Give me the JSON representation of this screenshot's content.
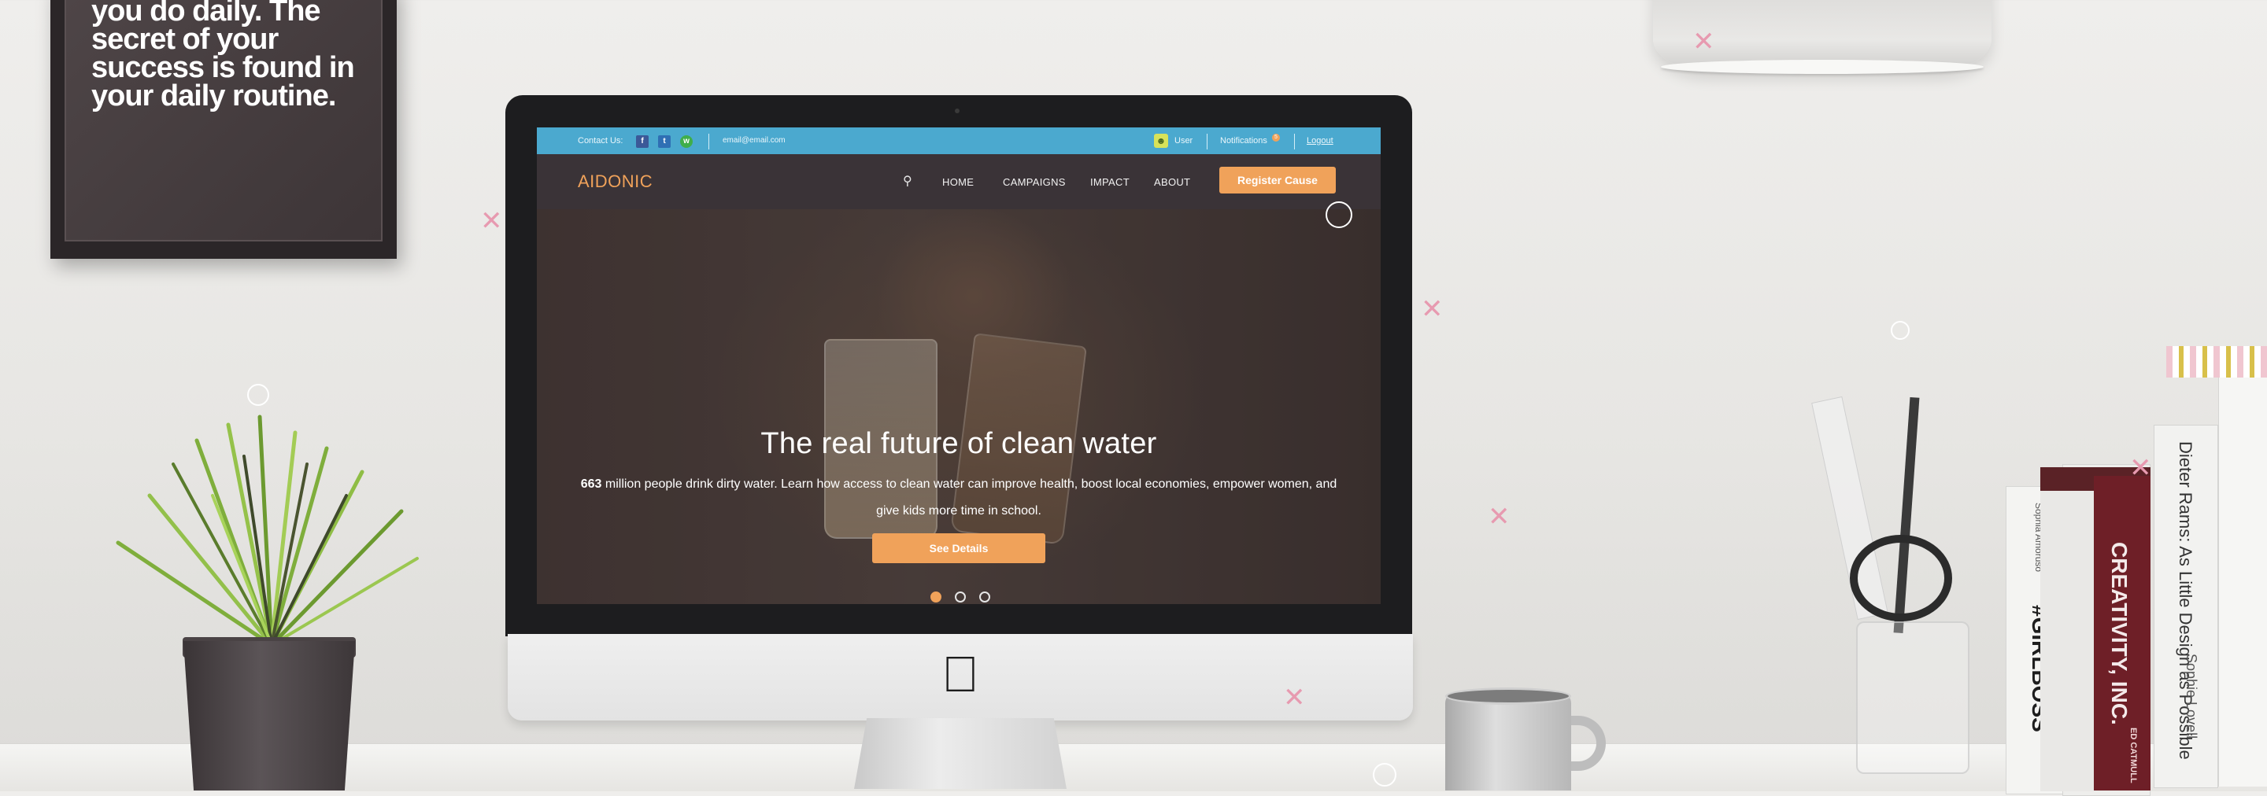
{
  "wall_quote": {
    "lines": [
      "you do daily. The",
      "secret of your",
      "success is found in",
      "your daily routine."
    ]
  },
  "website": {
    "contact_label": "Contact Us:",
    "social": [
      "f",
      "t",
      "w"
    ],
    "email": "email@email.com",
    "user_label": "User",
    "notifications_label": "Notifications",
    "notifications_count": "5",
    "logout_label": "Logout",
    "brand": "AIDONIC",
    "nav": [
      "HOME",
      "CAMPAIGNS",
      "IMPACT",
      "ABOUT"
    ],
    "register_label": "Register Cause",
    "hero": {
      "title": "The real future of clean water",
      "desc_number": "663",
      "desc_rest": " million people drink dirty water. Learn how access to clean water can improve health, boost local economies, empower women, and give kids more time in school.",
      "cta": "See Details",
      "slides": 3,
      "active_slide": 1
    },
    "colors": {
      "topbar": "#4ba9cf",
      "navbar": "#3a3438",
      "accent": "#f0a25a"
    }
  },
  "books": [
    {
      "title": "Dieter Rams: As Little Design as Possible",
      "author": "Sophie Lovell"
    },
    {
      "title": "CREATIVITY, INC.",
      "author": "ED CATMULL"
    },
    {
      "title": "#GIRLBOSS",
      "author": "Sophia Amoruso"
    }
  ],
  "icons": {
    "search": "search-icon",
    "apple": "apple-logo-icon"
  }
}
